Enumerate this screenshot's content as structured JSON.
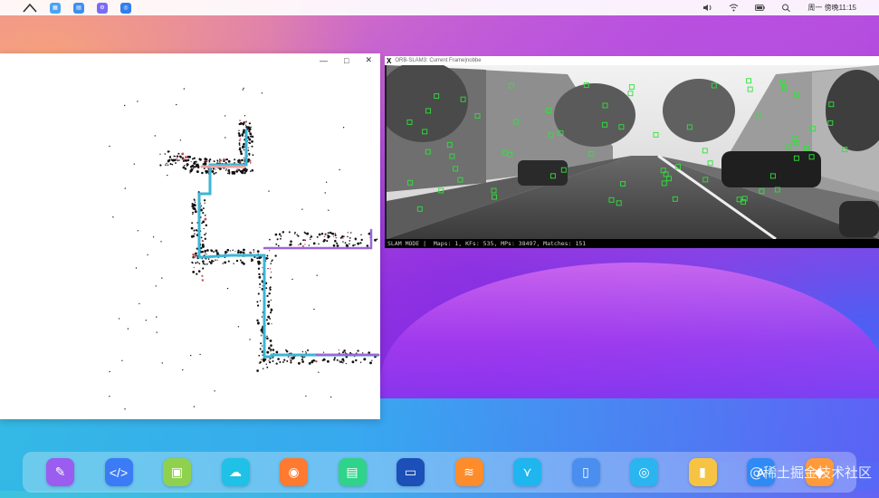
{
  "topbar": {
    "clock": "周一 傍晚11:15",
    "app_icons": [
      "apps-icon",
      "files-icon",
      "settings-icon",
      "browser-icon"
    ]
  },
  "map_window": {
    "controls": [
      "—",
      "□",
      "✕"
    ]
  },
  "frame_window": {
    "title": "ORB-SLAM3: Current Frame|nobbe",
    "status_text": "SLAM MODE |  Maps: 1, KFs: 535, MPs: 38497, Matches: 151"
  },
  "dock": {
    "icons": [
      {
        "name": "paint-app-icon",
        "color": "#9b5cf0",
        "glyph": "✎"
      },
      {
        "name": "code-editor-icon",
        "color": "#3b7bf5",
        "glyph": "</>"
      },
      {
        "name": "android-icon",
        "color": "#8fd14f",
        "glyph": "▣"
      },
      {
        "name": "cloud-icon",
        "color": "#1fc1e6",
        "glyph": "☁"
      },
      {
        "name": "lightbulb-icon",
        "color": "#ff7a2f",
        "glyph": "◉"
      },
      {
        "name": "document-icon",
        "color": "#2fd38a",
        "glyph": "▤"
      },
      {
        "name": "terminal-icon",
        "color": "#1c4fb8",
        "glyph": "▭"
      },
      {
        "name": "wave-app-icon",
        "color": "#ff8c2a",
        "glyph": "≋"
      },
      {
        "name": "butterfly-icon",
        "color": "#1fb6f0",
        "glyph": "⋎"
      },
      {
        "name": "book-icon",
        "color": "#4a8ef0",
        "glyph": "▯"
      },
      {
        "name": "planet-icon",
        "color": "#2ab4f0",
        "glyph": "◎"
      },
      {
        "name": "notes-icon",
        "color": "#f6c343",
        "glyph": "▮"
      },
      {
        "name": "app-store-icon",
        "color": "#2f8af5",
        "glyph": "A"
      },
      {
        "name": "game-icon",
        "color": "#ff9a3a",
        "glyph": "◆"
      }
    ]
  },
  "watermark": "@稀土掘金技术社区"
}
